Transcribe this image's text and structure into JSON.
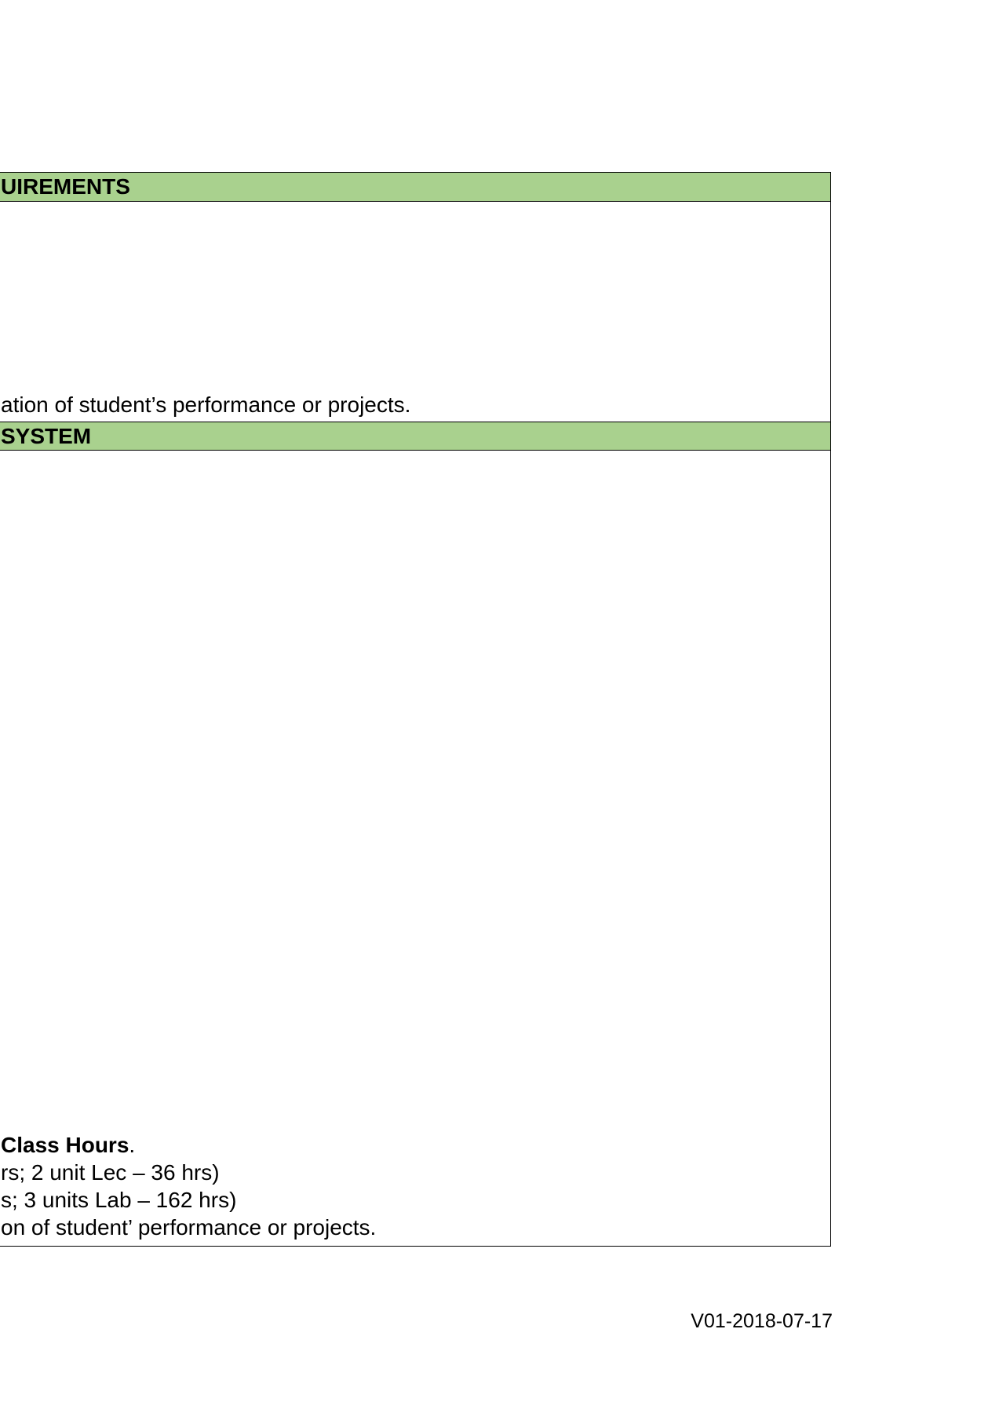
{
  "sections": [
    {
      "header": "UIREMENTS",
      "lines": [
        "ation of student’s performance or projects."
      ]
    },
    {
      "header": "SYSTEM",
      "class_hours_bold": "Class Hours",
      "class_hours_suffix": ".",
      "lines": [
        "rs; 2 unit Lec – 36 hrs)",
        "s; 3 units Lab – 162 hrs)",
        "on of student’ performance or projects."
      ]
    }
  ],
  "footer": {
    "version": "V01-2018-07-17"
  },
  "colors": {
    "header_fill": "#a9d18e",
    "border": "#000000"
  }
}
